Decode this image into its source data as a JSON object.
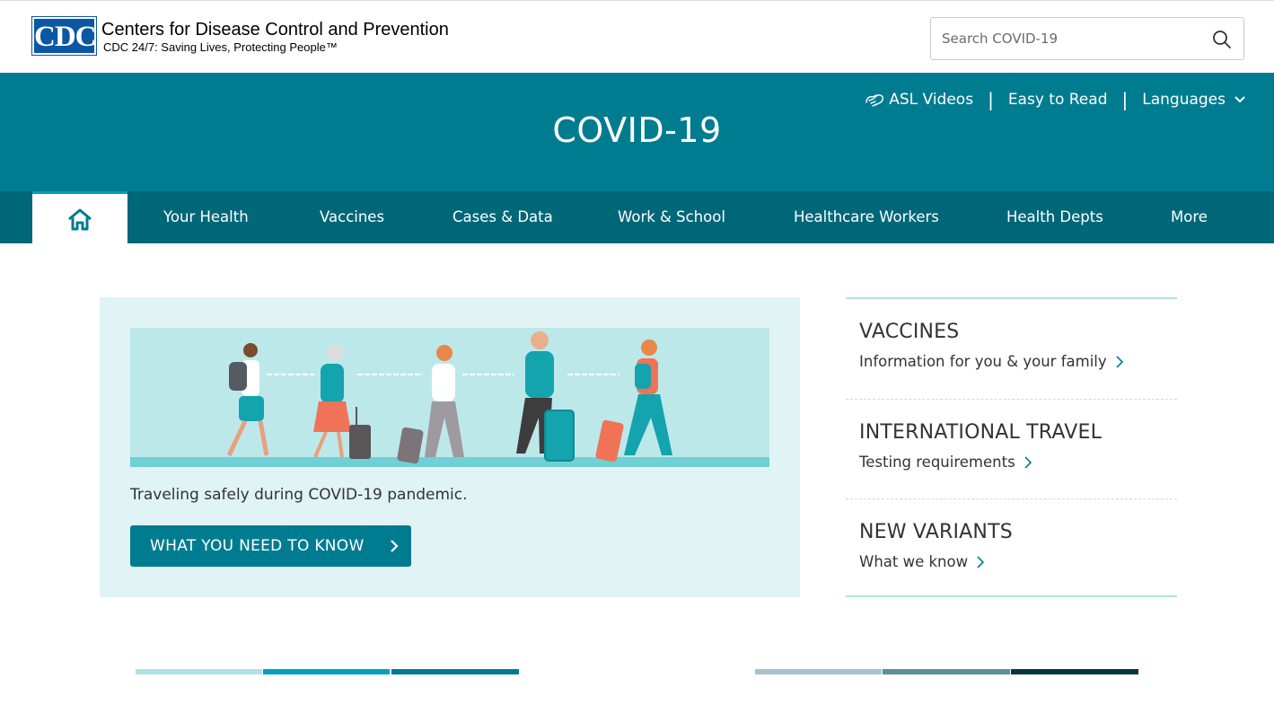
{
  "header": {
    "logo_badge": "CDC",
    "logo_title": "Centers for Disease Control and Prevention",
    "logo_tagline": "CDC 24/7: Saving Lives, Protecting People™",
    "search_placeholder": "Search COVID-19"
  },
  "banner": {
    "title": "COVID-19",
    "util_links": {
      "asl": "ASL Videos",
      "easy_read": "Easy to Read",
      "languages": "Languages",
      "separator": "|"
    }
  },
  "nav": {
    "items": [
      "Your Health",
      "Vaccines",
      "Cases & Data",
      "Work & School",
      "Healthcare Workers",
      "Health Depts",
      "More"
    ]
  },
  "feature": {
    "caption": "Traveling safely during COVID-19 pandemic.",
    "button_label": "WHAT YOU NEED TO KNOW"
  },
  "quick_links": [
    {
      "title": "VACCINES",
      "subtitle": "Information for you & your family"
    },
    {
      "title": "INTERNATIONAL TRAVEL",
      "subtitle": "Testing requirements"
    },
    {
      "title": "NEW VARIANTS",
      "subtitle": "What we know"
    }
  ],
  "colors": {
    "primary": "#007c91",
    "nav": "#006778",
    "feature_bg": "#e0f3f5",
    "illustration_bg": "#bde8ea",
    "bars_left": [
      "#b3e0e6",
      "#00a1ba",
      "#007c91"
    ],
    "bars_right": [
      "#a6c3cc",
      "#5b8f98",
      "#07363f"
    ]
  }
}
